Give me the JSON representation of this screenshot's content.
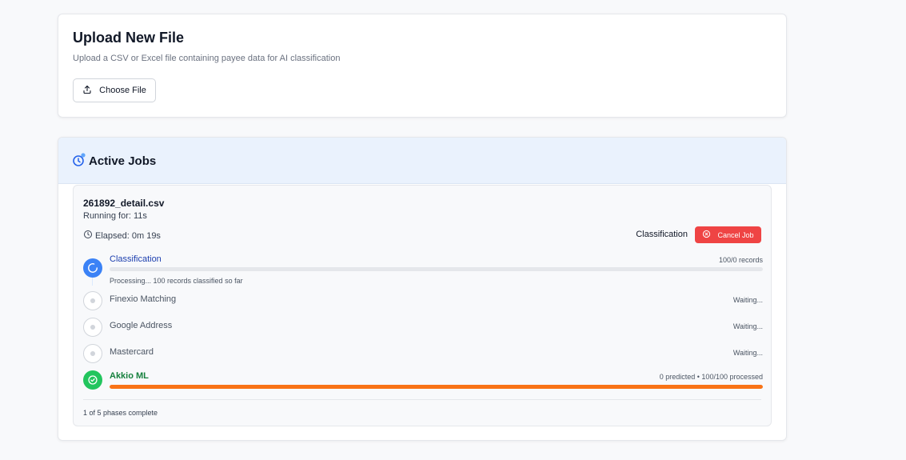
{
  "upload": {
    "title": "Upload New File",
    "subtitle": "Upload a CSV or Excel file containing payee data for AI classification",
    "choose_label": "Choose File"
  },
  "jobs": {
    "title": "Active Jobs",
    "job": {
      "filename": "261892_detail.csv",
      "running": "Running for: 11s",
      "elapsed": "Elapsed: 0m 19s",
      "current_phase": "Classification",
      "cancel_label": "Cancel Job",
      "phases": [
        {
          "name": "Classification",
          "state": "active",
          "status": "100/0 records",
          "detail": "Processing... 100 records classified so far",
          "progress": 0
        },
        {
          "name": "Finexio Matching",
          "state": "waiting",
          "status": "Waiting..."
        },
        {
          "name": "Google Address",
          "state": "waiting",
          "status": "Waiting..."
        },
        {
          "name": "Mastercard",
          "state": "waiting",
          "status": "Waiting..."
        },
        {
          "name": "Akkio ML",
          "state": "done",
          "status": "0 predicted • 100/100 processed",
          "progress": 1.0
        }
      ],
      "footer": "1 of 5 phases complete"
    }
  },
  "colors": {
    "active": "#3b82f6",
    "done": "#22c55e",
    "progress_orange": "#f97316",
    "cancel": "#ef4444"
  }
}
